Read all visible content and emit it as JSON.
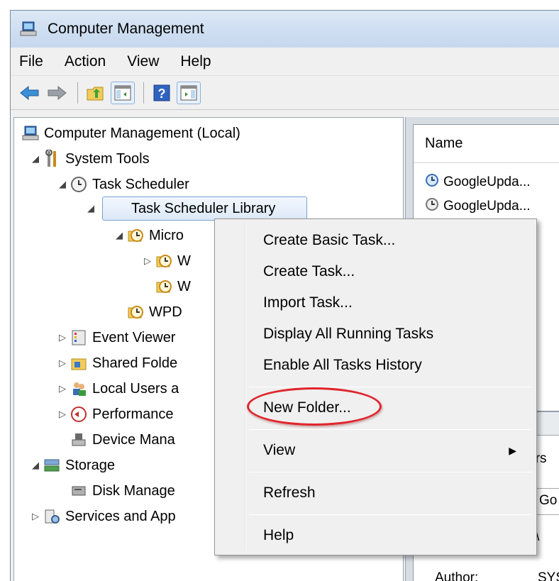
{
  "window": {
    "title": "Computer Management"
  },
  "menubar": {
    "items": [
      "File",
      "Action",
      "View",
      "Help"
    ]
  },
  "toolbar": {
    "icons": [
      "back-arrow-icon",
      "forward-arrow-icon",
      "up-folder-icon",
      "show-hide-tree-icon",
      "help-icon",
      "show-hide-action-pane-icon"
    ]
  },
  "tree": {
    "root": "Computer Management (Local)",
    "system_tools": "System Tools",
    "task_scheduler": "Task Scheduler",
    "task_scheduler_library": "Task Scheduler Library",
    "micro": "Micro",
    "w1": "W",
    "w2": "W",
    "wpd": "WPD",
    "event_viewer": "Event Viewer",
    "shared_folders": "Shared Folde",
    "local_users": "Local Users a",
    "performance": "Performance",
    "device_manager": "Device Mana",
    "storage": "Storage",
    "disk_management": "Disk Manage",
    "services": "Services and App"
  },
  "list": {
    "column_name": "Name",
    "rows": [
      "GoogleUpda...",
      "GoogleUpda..."
    ]
  },
  "details": {
    "tab": "ggers",
    "go": "Go",
    "slash": "\\",
    "author_label": "Author:",
    "author_value": "SYS"
  },
  "context_menu": {
    "create_basic_task": "Create Basic Task...",
    "create_task": "Create Task...",
    "import_task": "Import Task...",
    "display_running": "Display All Running Tasks",
    "enable_history": "Enable All Tasks History",
    "new_folder": "New Folder...",
    "view": "View",
    "refresh": "Refresh",
    "help": "Help"
  },
  "colors": {
    "highlight_ring": "#e0242c",
    "selection": "#dde9f8"
  }
}
